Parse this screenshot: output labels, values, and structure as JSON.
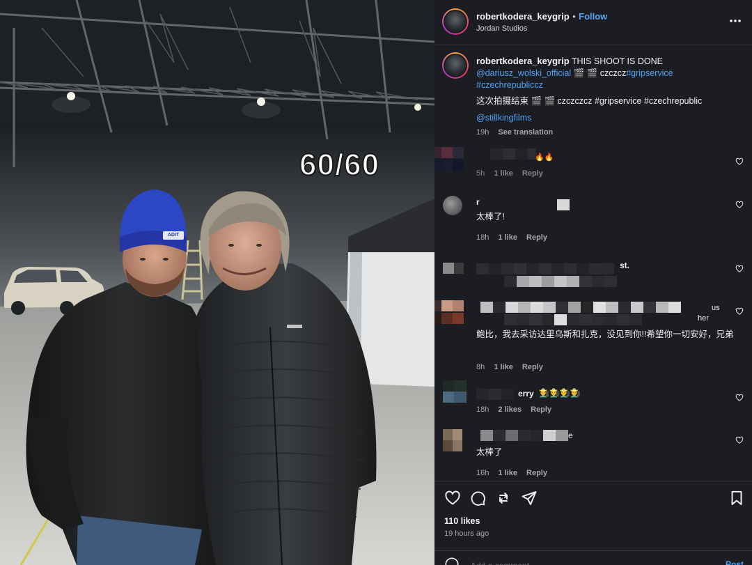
{
  "photo": {
    "overlay_text": "60/60",
    "beanie_label": "ADIT"
  },
  "header": {
    "username": "robertkodera_keygrip",
    "separator": "•",
    "follow_label": "Follow",
    "location": "Jordan Studios"
  },
  "caption": {
    "username": "robertkodera_keygrip",
    "line1_text": "THIS SHOOT IS DONE",
    "mention1": "@dariusz_wolski_official",
    "emojis1": "🎬 🎬",
    "text_czcz": "czczcz",
    "hashtag1": "#gripservice",
    "hashtag2": "#czechrepubliccz",
    "line2": "这次拍摄结束 🎬 🎬 czczczcz #gripservice #czechrepublic",
    "mention2": "@stillkingfilms",
    "time": "19h",
    "see_translation": "See translation"
  },
  "comments": [
    {
      "text": "🔥🔥",
      "time": "5h",
      "likes": "1 like",
      "reply": "Reply"
    },
    {
      "name_fragment": "r",
      "text": "太棒了!",
      "time": "18h",
      "likes": "1 like",
      "reply": "Reply"
    },
    {
      "name_fragment": "st.",
      "text": "",
      "time": "",
      "likes": "",
      "reply": ""
    },
    {
      "name_fragment": "us",
      "name_fragment2": "her",
      "text": "鲍比，我去采访达里乌斯和扎克，没见到你!!希望你一切安好，兄弟",
      "time": "8h",
      "likes": "1 like",
      "reply": "Reply"
    },
    {
      "name_fragment": "erry",
      "text": "👨‍🌾👨‍🌾👨‍🌾👨‍🌾",
      "time": "18h",
      "likes": "2 likes",
      "reply": "Reply"
    },
    {
      "name_fragment": "e",
      "text": "太棒了",
      "time": "16h",
      "likes": "1 like",
      "reply": "Reply"
    }
  ],
  "actions": {
    "likes": "110 likes",
    "posted_ago": "19 hours ago",
    "comment_placeholder": "Add a comment...",
    "post_label": "Post"
  },
  "icons": [
    "heart-icon",
    "comment-icon",
    "share-icon",
    "send-icon",
    "bookmark-icon",
    "more-icon",
    "emoji-icon"
  ],
  "colors": {
    "panel_bg": "#1c1d22",
    "link": "#4ea4f7",
    "muted": "#a8a8a8",
    "beanie": "#2c46c4"
  }
}
